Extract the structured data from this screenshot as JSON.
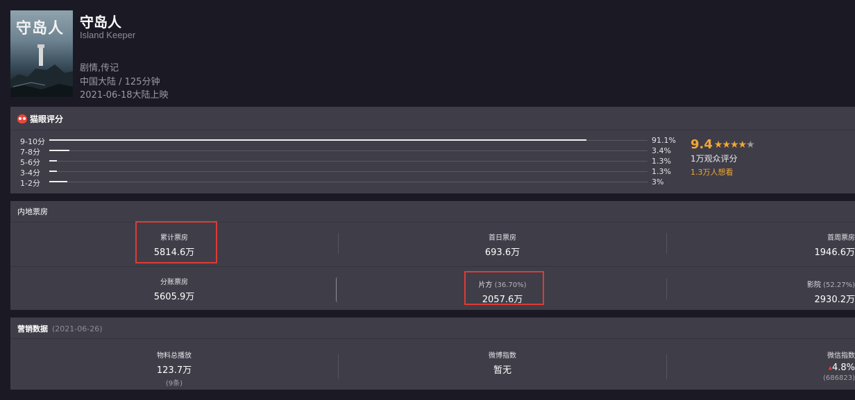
{
  "movie": {
    "title_cn": "守岛人",
    "title_en": "Island Keeper",
    "genre": "剧情,传记",
    "region_duration": "中国大陆 / 125分钟",
    "release": "2021-06-18大陆上映",
    "poster_title": "守岛人"
  },
  "rating": {
    "panel_title": "猫眼评分",
    "distribution": [
      {
        "label": "9-10分",
        "pct_text": "91.1%",
        "fraction": 0.911
      },
      {
        "label": "7-8分",
        "pct_text": "3.4%",
        "fraction": 0.034
      },
      {
        "label": "5-6分",
        "pct_text": "1.3%",
        "fraction": 0.013
      },
      {
        "label": "3-4分",
        "pct_text": "1.3%",
        "fraction": 0.013
      },
      {
        "label": "1-2分",
        "pct_text": "3%",
        "fraction": 0.03
      }
    ],
    "score": "9.4",
    "stars": "4.5 of 5",
    "people": "1万观众评分",
    "want": "1.3万人想看",
    "accent_color": "#f3a734"
  },
  "boxoffice": {
    "panel_title": "内地票房",
    "cumulative_label": "累计票房",
    "cumulative_value": "5814.6万",
    "first_day_label": "首日票房",
    "first_day_value": "693.6万",
    "first_week_label": "首周票房",
    "first_week_value": "1946.6万",
    "split_label": "分账票房",
    "split_value": "5605.9万",
    "producer_label": "片方",
    "producer_pct": "(36.70%)",
    "producer_value": "2057.6万",
    "cinema_label": "影院",
    "cinema_pct": "(52.27%)",
    "cinema_value": "2930.2万",
    "highlight_color": "#e03a36"
  },
  "marketing": {
    "panel_title": "营销数据",
    "date": "(2021-06-26)",
    "materials_label": "物料总播放",
    "materials_value": "123.7万",
    "materials_extra": "(9条)",
    "weibo_label": "微博指数",
    "weibo_value": "暂无",
    "wechat_label": "微信指数",
    "wechat_value": "4.8%",
    "wechat_extra": "(686823)"
  },
  "icons": {
    "rating_icon": "cat-eye-icon",
    "trend_icon": "up-arrow-icon"
  }
}
